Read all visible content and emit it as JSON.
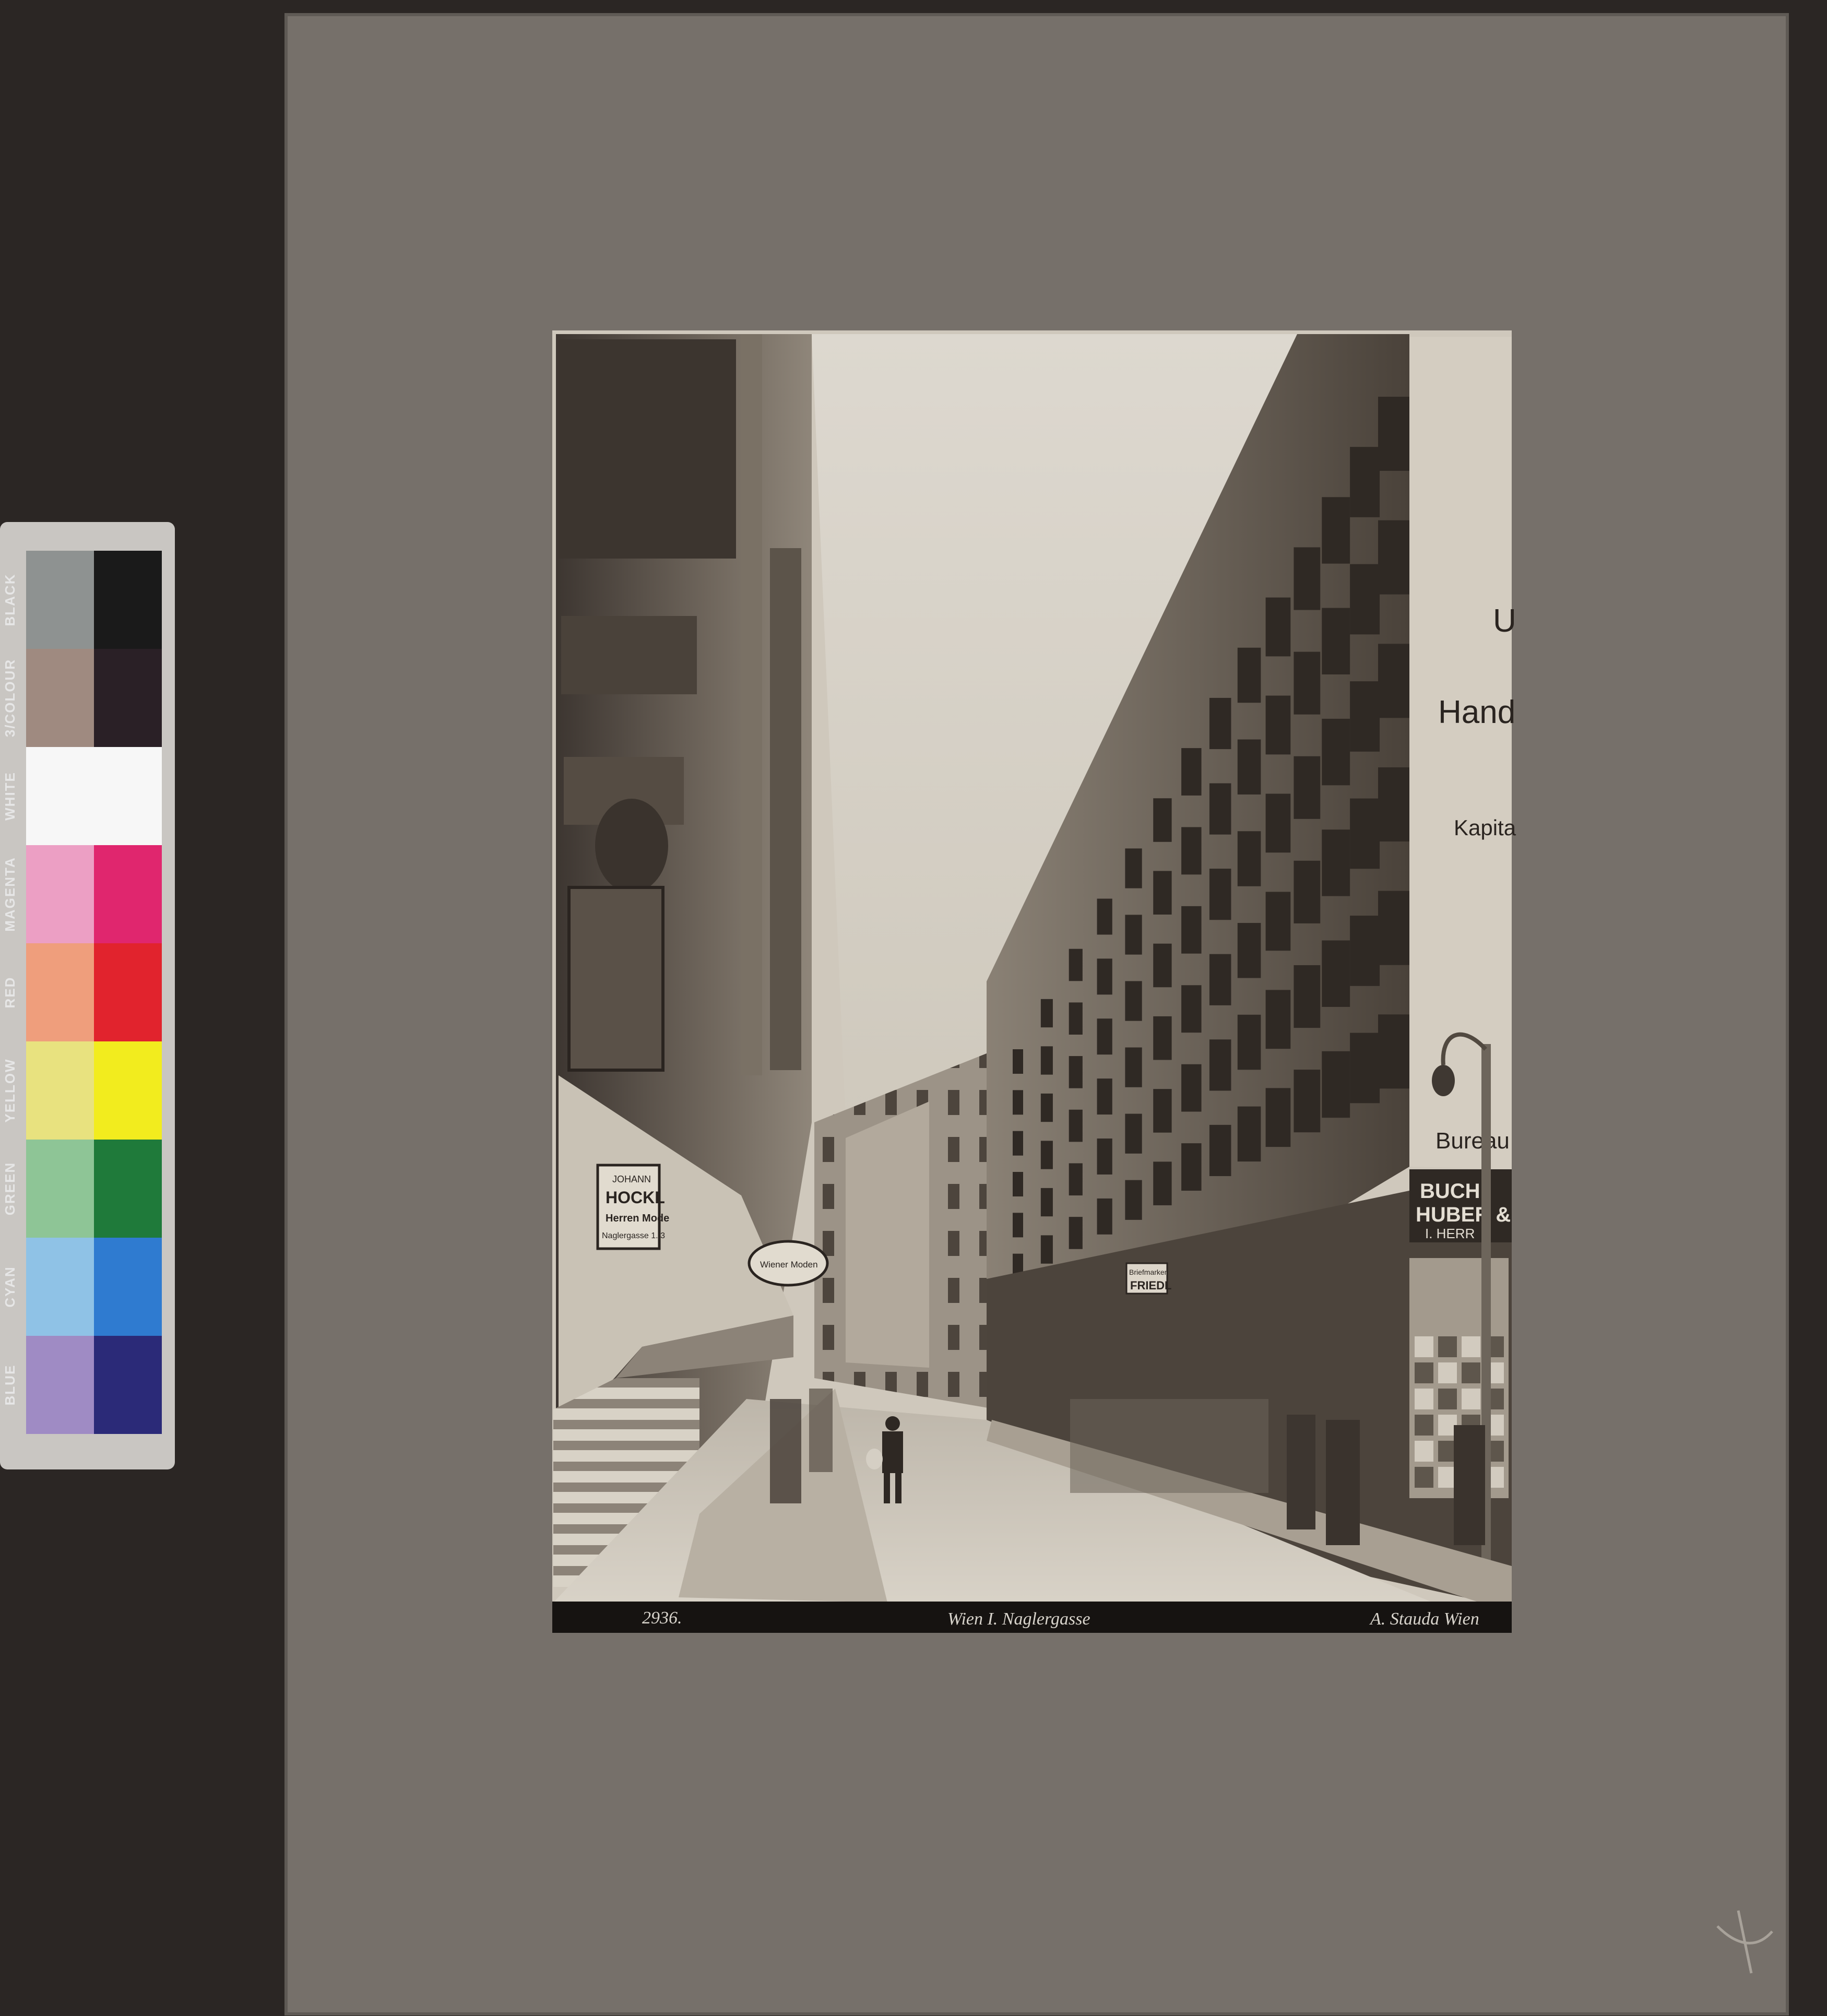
{
  "color_chart": {
    "labels": [
      "BLACK",
      "3/COLOUR",
      "WHITE",
      "MAGENTA",
      "RED",
      "YELLOW",
      "GREEN",
      "CYAN",
      "BLUE"
    ],
    "patches": [
      [
        "#8e9291",
        "#1a1a1a"
      ],
      [
        "#9f8a80",
        "#2a2026"
      ],
      [
        "#f7f7f7",
        "#f7f7f7"
      ],
      [
        "#ec9fc4",
        "#e0266e"
      ],
      [
        "#ef9e7c",
        "#e1232d"
      ],
      [
        "#e8e27f",
        "#f2ec1e"
      ],
      [
        "#8ec596",
        "#1f7a3a"
      ],
      [
        "#8fc2e6",
        "#2f7bd0"
      ],
      [
        "#9f8bc4",
        "#2b2a78"
      ]
    ]
  },
  "photo": {
    "building_text": [
      "U",
      "Hand",
      "Kapita",
      "Bureau"
    ],
    "signs": {
      "hockl": [
        "JOHANN",
        "HOCKL",
        "Herren Mode",
        "Naglergasse 1. 3"
      ],
      "wein": "Wiener Moden",
      "friedl": [
        "Briefmarken",
        "FRIEDL"
      ],
      "huber": [
        "BUCH",
        "HUBER &",
        "I. HERR"
      ]
    },
    "caption": {
      "number": "2936.",
      "title": "Wien I. Naglergasse",
      "credit": "A. Stauda Wien"
    }
  },
  "colors": {
    "background": "#2b2624",
    "mount": "#76706a",
    "photo_tone": "#cfc8bc",
    "caption_band": "#161311"
  }
}
